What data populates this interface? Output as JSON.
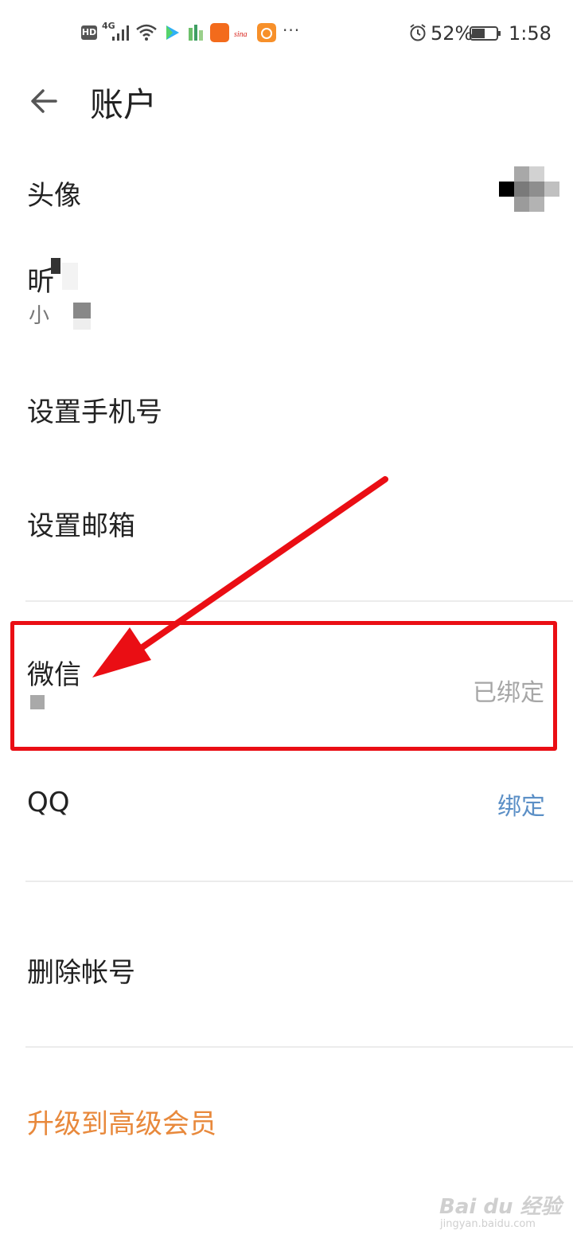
{
  "status_bar": {
    "hd": "HD",
    "network": "4G",
    "battery_percent": "52%",
    "time": "1:58",
    "more": "···",
    "app_icons": [
      "video-play-icon",
      "green-app-icon",
      "orange-app-icon",
      "sina-icon",
      "uc-browser-icon"
    ]
  },
  "header": {
    "title": "账户",
    "back_icon": "arrow-left-icon"
  },
  "rows": {
    "avatar_label": "头像",
    "nickname_label": "昕",
    "nickname_sub": "小",
    "phone_label": "设置手机号",
    "email_label": "设置邮箱",
    "wechat_label": "微信",
    "wechat_status": "已绑定",
    "qq_label": "QQ",
    "qq_action": "绑定",
    "delete_label": "删除帐号"
  },
  "upgrade": "升级到高级会员",
  "watermark": {
    "brand": "Bai du 经验",
    "url": "jingyan.baidu.com"
  },
  "colors": {
    "accent_orange": "#e8893c",
    "link_blue": "#5b8fc6",
    "annotation_red": "#ea0e14"
  }
}
